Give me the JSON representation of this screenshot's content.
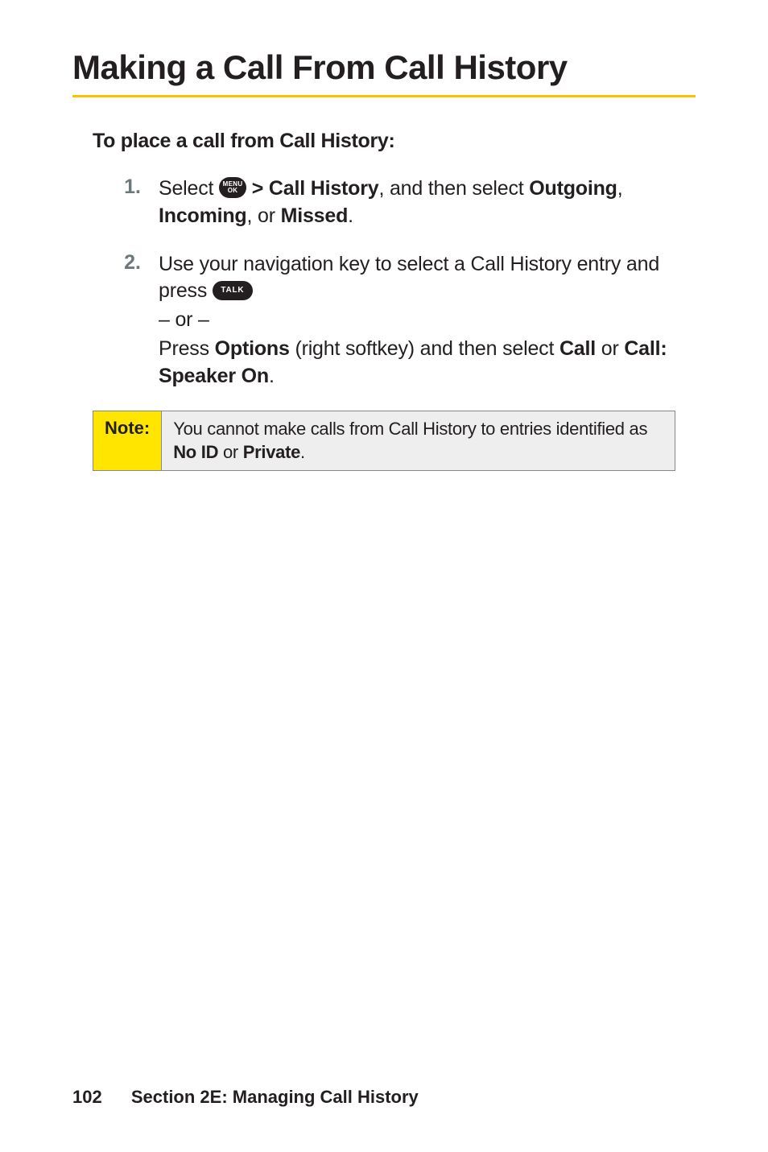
{
  "heading": "Making a Call From Call History",
  "subhead": "To place a call from Call History:",
  "steps": [
    {
      "num": "1.",
      "parts": {
        "a": "Select ",
        "b": " > Call History",
        "c": ", and then select ",
        "d": "Outgoing",
        "e": ", ",
        "f": "Incoming",
        "g": ", or ",
        "h": "Missed",
        "i": "."
      }
    },
    {
      "num": "2.",
      "parts": {
        "a": "Use your navigation key to select a Call History entry and press ",
        "or": "– or –",
        "b": "Press ",
        "c": "Options",
        "d": " (right softkey) and then select ",
        "e": "Call",
        "f": " or ",
        "g": "Call: Speaker On",
        "h": "."
      }
    }
  ],
  "icons": {
    "menu_top": "MENU",
    "menu_bottom": "OK",
    "talk": "TALK"
  },
  "note": {
    "label": "Note:",
    "a": "You cannot make calls from Call History to entries identified as ",
    "b": "No ID",
    "c": " or ",
    "d": "Private",
    "e": "."
  },
  "footer": {
    "page": "102",
    "section": "Section 2E: Managing Call History"
  }
}
